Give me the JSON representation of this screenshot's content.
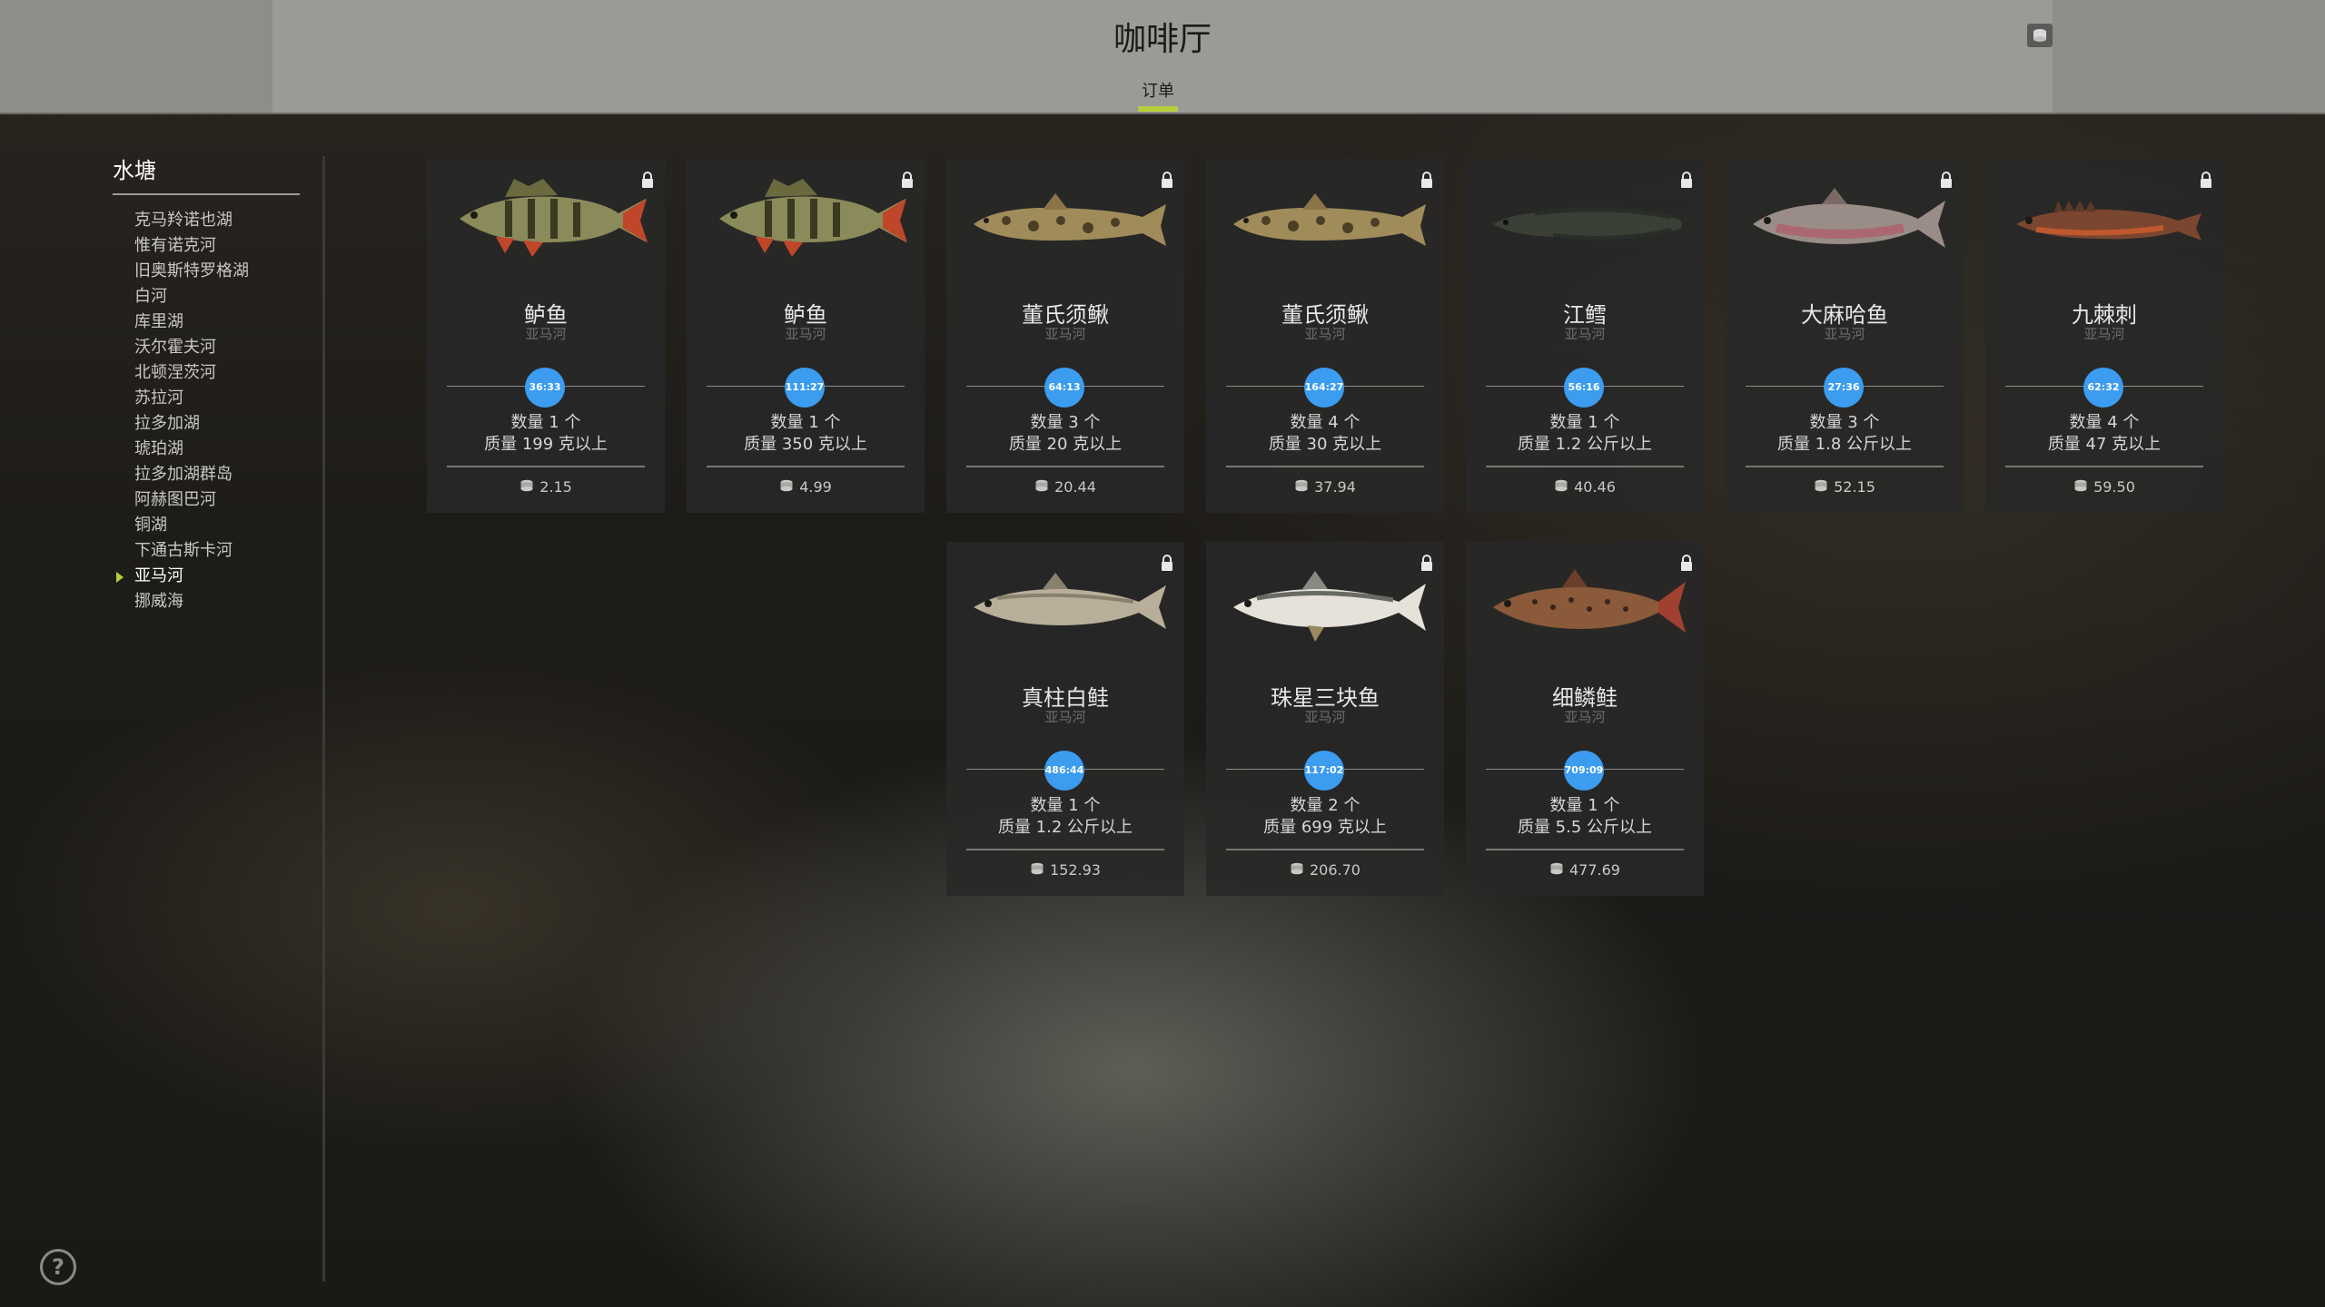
{
  "header": {
    "title": "咖啡厅",
    "tab_label": "订单",
    "wallet_icon": "wallet-icon"
  },
  "sidebar": {
    "heading": "水塘",
    "items": [
      {
        "label": "克马羚诺也湖",
        "active": false
      },
      {
        "label": "惟有诺克河",
        "active": false
      },
      {
        "label": "旧奥斯特罗格湖",
        "active": false
      },
      {
        "label": "白河",
        "active": false
      },
      {
        "label": "库里湖",
        "active": false
      },
      {
        "label": "沃尔霍夫河",
        "active": false
      },
      {
        "label": "北顿涅茨河",
        "active": false
      },
      {
        "label": "苏拉河",
        "active": false
      },
      {
        "label": "拉多加湖",
        "active": false
      },
      {
        "label": "琥珀湖",
        "active": false
      },
      {
        "label": "拉多加湖群岛",
        "active": false
      },
      {
        "label": "阿赫图巴河",
        "active": false
      },
      {
        "label": "铜湖",
        "active": false
      },
      {
        "label": "下通古斯卡河",
        "active": false
      },
      {
        "label": "亚马河",
        "active": true
      },
      {
        "label": "挪威海",
        "active": false
      }
    ]
  },
  "orders": [
    {
      "name": "鲈鱼",
      "location": "亚马河",
      "timer": "36:33",
      "quantity": "数量 1 个",
      "mass": "质量 199 克以上",
      "price": "2.15",
      "fish": "perch"
    },
    {
      "name": "鲈鱼",
      "location": "亚马河",
      "timer": "111:27",
      "quantity": "数量 1 个",
      "mass": "质量 350 克以上",
      "price": "4.99",
      "fish": "perch"
    },
    {
      "name": "董氏须鳅",
      "location": "亚马河",
      "timer": "64:13",
      "quantity": "数量 3 个",
      "mass": "质量 20 克以上",
      "price": "20.44",
      "fish": "loach"
    },
    {
      "name": "董氏须鳅",
      "location": "亚马河",
      "timer": "164:27",
      "quantity": "数量 4 个",
      "mass": "质量 30 克以上",
      "price": "37.94",
      "fish": "loach"
    },
    {
      "name": "江鳕",
      "location": "亚马河",
      "timer": "56:16",
      "quantity": "数量 1 个",
      "mass": "质量 1.2 公斤以上",
      "price": "40.46",
      "fish": "burbot"
    },
    {
      "name": "大麻哈鱼",
      "location": "亚马河",
      "timer": "27:36",
      "quantity": "数量 3 个",
      "mass": "质量 1.8 公斤以上",
      "price": "52.15",
      "fish": "salmon"
    },
    {
      "name": "九棘刺",
      "location": "亚马河",
      "timer": "62:32",
      "quantity": "数量 4 个",
      "mass": "质量 47 克以上",
      "price": "59.50",
      "fish": "stickleback"
    },
    {
      "name": "真柱白鲑",
      "location": "亚马河",
      "timer": "486:44",
      "quantity": "数量 1 个",
      "mass": "质量 1.2 公斤以上",
      "price": "152.93",
      "fish": "whitefish"
    },
    {
      "name": "珠星三块鱼",
      "location": "亚马河",
      "timer": "117:02",
      "quantity": "数量 2 个",
      "mass": "质量 699 克以上",
      "price": "206.70",
      "fish": "dace"
    },
    {
      "name": "细鳞鲑",
      "location": "亚马河",
      "timer": "709:09",
      "quantity": "数量 1 个",
      "mass": "质量 5.5 公斤以上",
      "price": "477.69",
      "fish": "lenok"
    }
  ],
  "colors": {
    "accent": "#b4cf3b",
    "timer": "#3b9cf0"
  }
}
